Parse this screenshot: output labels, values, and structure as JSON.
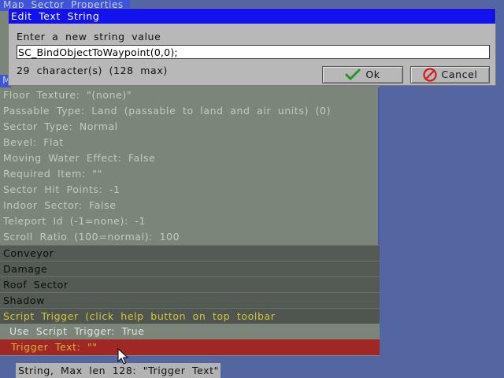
{
  "background_window": {
    "title": "Map Sector Properties",
    "header_fragment": "Ma",
    "properties": [
      "Floor Texture: \"(none)\"",
      "Passable Type: Land (passable to land and air units) (0)",
      "Sector Type: Normal",
      "Bevel: Flat",
      "Moving Water Effect: False",
      "Required Item: \"\"",
      "Sector Hit Points: -1",
      "Indoor Sector: False",
      "Teleport Id (-1=none): -1",
      "Scroll Ratio (100=normal): 100"
    ],
    "categories": [
      "Conveyor",
      "Damage",
      "Roof Sector",
      "Shadow"
    ],
    "script_category": "Script Trigger (click help button on top toolbar",
    "script_items": {
      "use_trigger": "Use Script Trigger: True",
      "trigger_text": "Trigger Text: \"\""
    }
  },
  "status_bar": {
    "text": "String, Max len 128: \"Trigger Text\""
  },
  "dialog": {
    "title_parts": [
      "Edit",
      "Text",
      "String"
    ],
    "prompt": "Enter a new string value",
    "value": "SC_BindObjectToWaypoint(0,0);",
    "char_count": "29 character(s) (128 max)",
    "ok_label": "Ok",
    "cancel_label": "Cancel"
  },
  "icons": {
    "ok": "checkmark-icon",
    "cancel": "no-entry-icon",
    "pointer": "mouse-cursor-icon"
  },
  "colors": {
    "desktop": "#5366a1",
    "dialog_title": "#1212ef",
    "selected_row": "#a02724",
    "script_text": "#d9c53a"
  }
}
